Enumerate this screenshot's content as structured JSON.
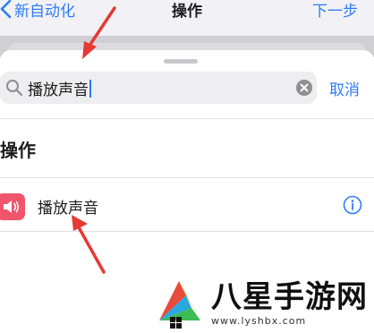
{
  "navbar": {
    "back_label": "新自动化",
    "title": "操作",
    "next_label": "下一步"
  },
  "search": {
    "query": "播放声音",
    "cancel_label": "取消"
  },
  "section": {
    "title": "操作"
  },
  "actions": [
    {
      "label": "播放声音",
      "icon": "speaker-icon",
      "icon_color": "#f0556b"
    }
  ],
  "watermark": {
    "text": "八星手游网",
    "url": "www.lyshbx.com"
  },
  "colors": {
    "accent": "#2f7cf6",
    "annotation_arrow": "#e53935"
  }
}
